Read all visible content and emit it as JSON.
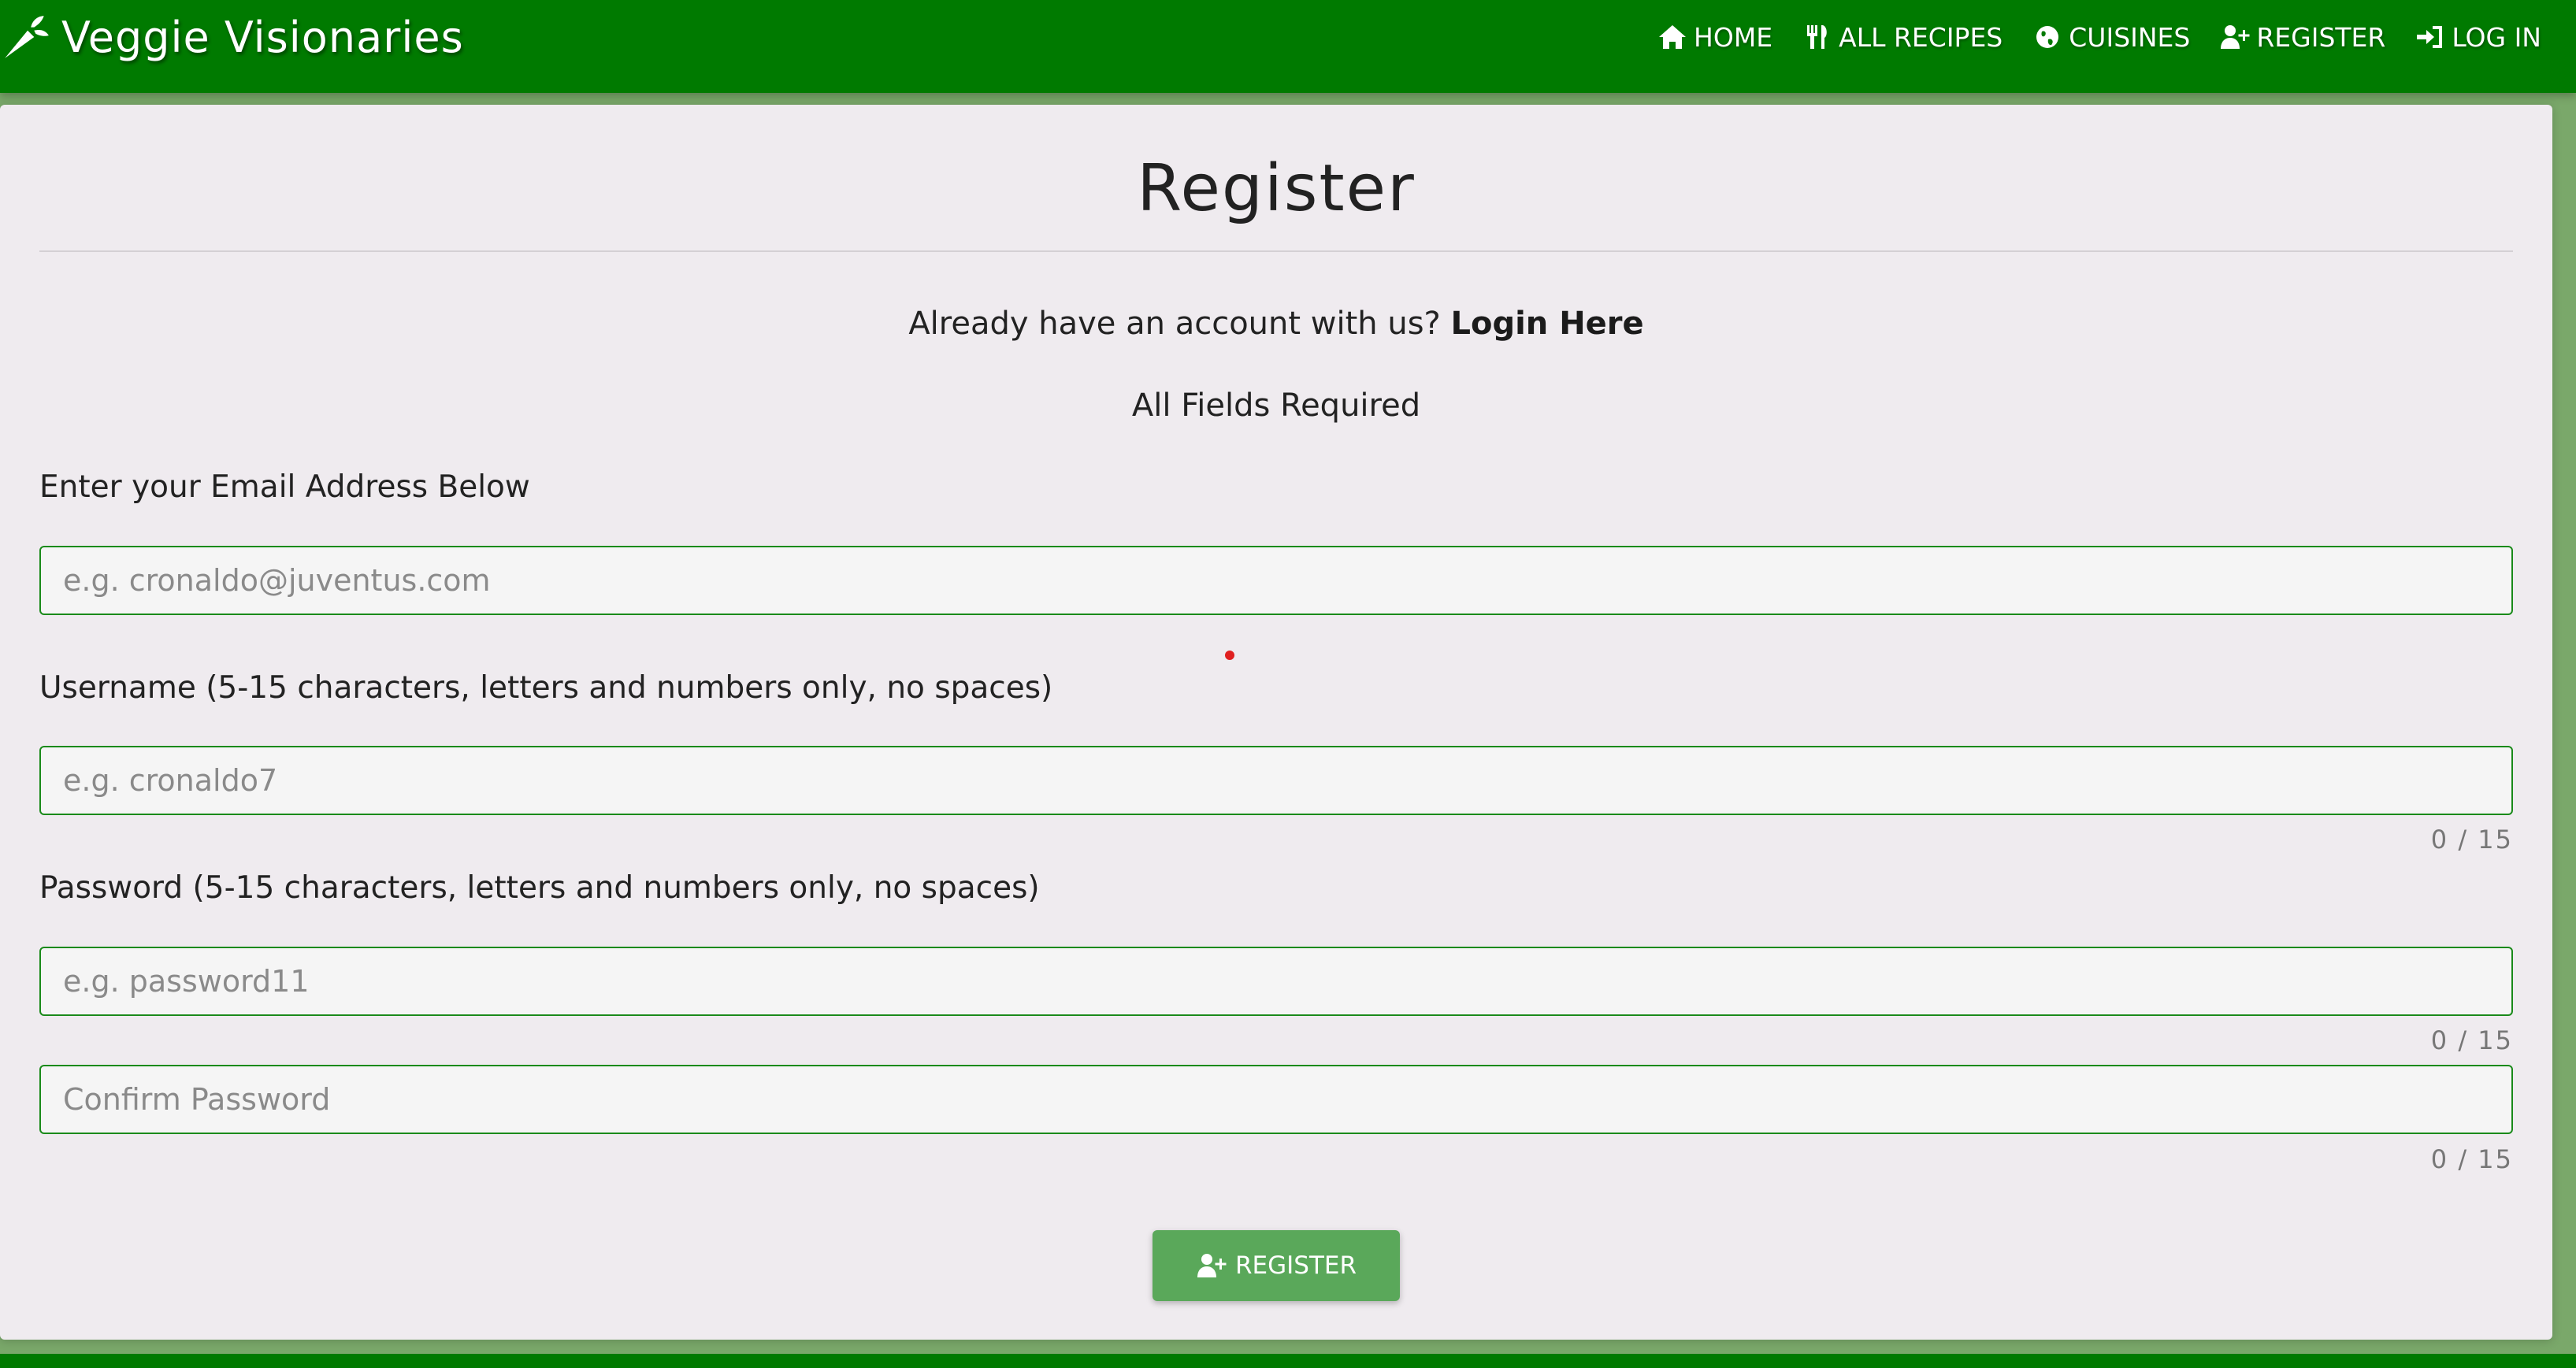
{
  "brand": {
    "name": "Veggie Visionaries",
    "logo_icon": "carrot-icon"
  },
  "nav": {
    "items": [
      {
        "label": "HOME",
        "icon": "home-icon"
      },
      {
        "label": "ALL RECIPES",
        "icon": "utensils-icon"
      },
      {
        "label": "CUISINES",
        "icon": "globe-icon"
      },
      {
        "label": "REGISTER",
        "icon": "user-plus-icon"
      },
      {
        "label": "LOG IN",
        "icon": "sign-in-icon"
      }
    ]
  },
  "form": {
    "title": "Register",
    "login_prompt": "Already have an account with us?",
    "login_link": "Login Here",
    "required_note": "All Fields Required",
    "email": {
      "label": "Enter your Email Address Below",
      "placeholder": "e.g. cronaldo@juventus.com",
      "value": ""
    },
    "username": {
      "label": "Username (5-15 characters, letters and numbers only, no spaces)",
      "placeholder": "e.g. cronaldo7",
      "value": "",
      "counter": "0 / 15"
    },
    "password": {
      "label": "Password (5-15 characters, letters and numbers only, no spaces)",
      "placeholder": "e.g. password11",
      "value": "",
      "counter": "0 / 15"
    },
    "confirm_password": {
      "placeholder": "Confirm Password",
      "value": "",
      "counter": "0 / 15"
    },
    "submit_label": "REGISTER",
    "submit_icon": "user-plus-icon"
  },
  "colors": {
    "navbar": "#007a00",
    "card": "#efebef",
    "field_border": "#1a8a1a",
    "button": "#5aa85a",
    "page_background": "#7aa86a"
  }
}
